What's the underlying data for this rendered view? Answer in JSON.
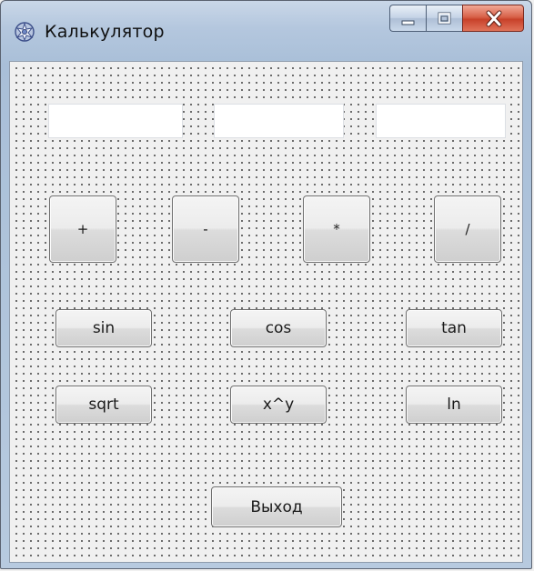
{
  "window": {
    "title": "Калькулятор",
    "icon": "calculator-app-icon"
  },
  "caption_buttons": {
    "minimize": "minimize-icon",
    "maximize": "maximize-icon",
    "close": "close-icon"
  },
  "fields": [
    {
      "value": "",
      "placeholder": ""
    },
    {
      "value": "",
      "placeholder": ""
    },
    {
      "value": "",
      "placeholder": ""
    }
  ],
  "operators": [
    "+",
    "-",
    "*",
    "/"
  ],
  "functions": {
    "row1": [
      "sin",
      "cos",
      "tan"
    ],
    "row2": [
      "sqrt",
      "x^y",
      "ln"
    ]
  },
  "exit_label": "Выход"
}
